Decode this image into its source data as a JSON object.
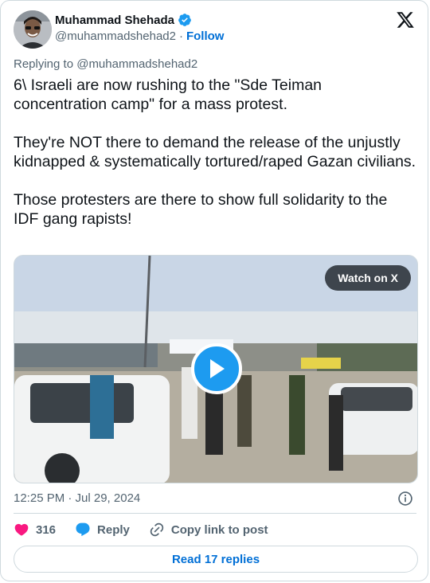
{
  "author": {
    "name": "Muhammad Shehada",
    "handle": "@muhammadshehad2",
    "follow_label": "Follow",
    "separator": "·"
  },
  "replying_to": "Replying to @muhammadshehad2",
  "tweet": {
    "text": "6\\ Israeli are now rushing to the \"Sde Teiman concentration camp\" for a mass protest.\n\nThey're NOT there to demand the release of the unjustly kidnapped & systematically tortured/raped Gazan civilians.\n\nThose protesters are there to show full solidarity to the IDF gang rapists!"
  },
  "media": {
    "watch_label": "Watch on X"
  },
  "timestamp": "12:25 PM · Jul 29, 2024",
  "actions": {
    "likes_count": "316",
    "reply_label": "Reply",
    "copy_label": "Copy link to post"
  },
  "read_replies_label": "Read 17 replies",
  "colors": {
    "accent": "#1d9bf0",
    "link": "#006fd6",
    "like": "#f91880",
    "text": "#0f1419",
    "muted": "#536471"
  }
}
